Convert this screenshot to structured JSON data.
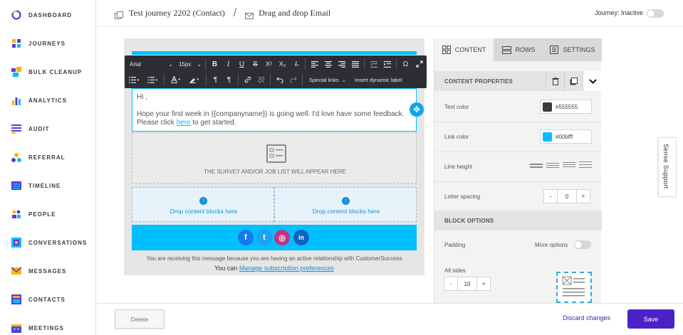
{
  "sidebar": {
    "items": [
      {
        "label": "DASHBOARD",
        "icon": "dashboard-icon"
      },
      {
        "label": "JOURNEYS",
        "icon": "journeys-icon"
      },
      {
        "label": "BULK CLEANUP",
        "icon": "bulk-cleanup-icon"
      },
      {
        "label": "ANALYTICS",
        "icon": "analytics-icon"
      },
      {
        "label": "AUDIT",
        "icon": "audit-icon"
      },
      {
        "label": "REFERRAL",
        "icon": "referral-icon"
      },
      {
        "label": "TIMELINE",
        "icon": "timeline-icon"
      },
      {
        "label": "PEOPLE",
        "icon": "people-icon"
      },
      {
        "label": "CONVERSATIONS",
        "icon": "conversations-icon"
      },
      {
        "label": "MESSAGES",
        "icon": "messages-icon"
      },
      {
        "label": "CONTACTS",
        "icon": "contacts-icon"
      },
      {
        "label": "MEETINGS",
        "icon": "meetings-icon"
      }
    ]
  },
  "header": {
    "journey_title": "Test journey 2202 (Contact)",
    "separator": "/",
    "step_title": "Drag and drop Email",
    "journey_status": "Journey: Inactive"
  },
  "toolbar": {
    "font_family": "Arial",
    "font_size": "15px",
    "bold": "B",
    "italic": "I",
    "underline": "U",
    "strike": "S",
    "superscript": "X²",
    "subscript": "X₂",
    "clear_format": "I̶",
    "omega": "Ω",
    "paragraph": "¶",
    "special_links": "Special links",
    "insert_dynamic_label": "Insert dynamic label"
  },
  "email": {
    "greeting": "Hi  ,",
    "body_line1": "Hope your first week in {{companyname}}  is going well. I'd love have some feedback.",
    "body_line2_pre": "Please click ",
    "body_link": "here",
    "body_line2_post": "  to get started.",
    "survey_text": "THE SURVEY AND/OR JOB LIST WILL APPEAR HERE",
    "drop_left": "Drop content blocks here",
    "drop_right": "Drop content blocks here",
    "social": {
      "facebook": "f",
      "twitter": "t",
      "instagram": "◎",
      "linkedin": "in"
    },
    "footer_line1": "You are receiving this message because you are having an active relationship with CustomerSuccess",
    "footer_pre": "You can ",
    "footer_link": "Manage subscription preferences"
  },
  "panel": {
    "tabs": [
      {
        "label": "CONTENT",
        "active": true
      },
      {
        "label": "ROWS",
        "active": false
      },
      {
        "label": "SETTINGS",
        "active": false
      }
    ],
    "content_properties": "CONTENT PROPERTIES",
    "text_color_label": "Text color",
    "text_color_value": "#555555",
    "link_color_label": "Link color",
    "link_color_value": "#00bfff",
    "line_height_label": "Line height",
    "letter_spacing_label": "Letter spacing",
    "letter_spacing_value": "0",
    "block_options": "BLOCK OPTIONS",
    "padding_label": "Padding",
    "more_options_label": "More options",
    "all_sides_label": "All sides",
    "padding_value": "10",
    "minus": "-",
    "plus": "+"
  },
  "sense_support": "Sense Support",
  "footer": {
    "delete_label": "Delete",
    "discard_label": "Discard changes",
    "save_label": "Save"
  },
  "colors": {
    "accent": "#00bfff",
    "primary": "#4c22c8",
    "text_color": "#555555"
  }
}
